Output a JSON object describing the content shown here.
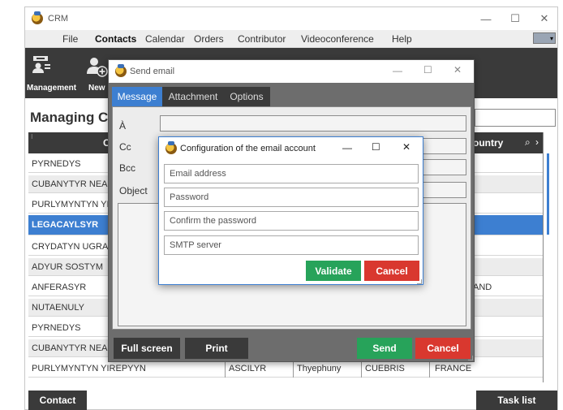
{
  "app": {
    "title": "CRM"
  },
  "menu": [
    "File",
    "Contacts",
    "Calendar",
    "Orders",
    "Contributor",
    "Videoconference",
    "Help"
  ],
  "menu_active": "Contacts",
  "ribbon": {
    "management": "Management",
    "new": "New"
  },
  "page_title": "Managing C",
  "grid": {
    "col2_header": "C",
    "country_header": "ountry",
    "rows": [
      {
        "name": "PYRNEDYS",
        "c2": "",
        "c3": "",
        "c4": "",
        "country": ""
      },
      {
        "name": "CUBANYTYR NEASY",
        "c2": "",
        "c3": "",
        "c4": "",
        "country": ""
      },
      {
        "name": "PURLYMYNTYN YIR",
        "c2": "",
        "c3": "",
        "c4": "",
        "country": ""
      },
      {
        "name": "LEGACAYLSYR",
        "c2": "",
        "c3": "",
        "c4": "",
        "country": ""
      },
      {
        "name": "CRYDATYN UGRACE",
        "c2": "",
        "c3": "",
        "c4": "",
        "country": ""
      },
      {
        "name": "ADYUR SOSTYM",
        "c2": "",
        "c3": "",
        "c4": "",
        "country": ""
      },
      {
        "name": "ANFERASYR",
        "c2": "",
        "c3": "",
        "c4": "",
        "country": "AND"
      },
      {
        "name": "NUTAENULY",
        "c2": "",
        "c3": "",
        "c4": "",
        "country": ""
      },
      {
        "name": "PYRNEDYS",
        "c2": "",
        "c3": "",
        "c4": "",
        "country": ""
      },
      {
        "name": "CUBANYTYR NEASY",
        "c2": "",
        "c3": "",
        "c4": "",
        "country": ""
      },
      {
        "name": "PURLYMYNTYN YIREPYYN",
        "c2": "ASCILYR",
        "c3": "Thyephuny",
        "c4": "CUEBRIS",
        "country": "FRANCE"
      }
    ]
  },
  "bottom": {
    "contact": "Contact",
    "task_list": "Task list"
  },
  "send_email": {
    "title": "Send email",
    "tabs": [
      "Message",
      "Attachment",
      "Options"
    ],
    "labels": {
      "to": "À",
      "cc": "Cc",
      "bcc": "Bcc",
      "object": "Object"
    },
    "buttons": {
      "full_screen": "Full screen",
      "print": "Print",
      "send": "Send",
      "cancel": "Cancel"
    }
  },
  "config": {
    "title": "Configuration of the email account",
    "placeholders": {
      "email": "Email address",
      "password": "Password",
      "confirm": "Confirm the password",
      "smtp": "SMTP server"
    },
    "buttons": {
      "validate": "Validate",
      "cancel": "Cancel"
    }
  },
  "colors": {
    "dark": "#3a3a3a",
    "selected": "#3d7fd1",
    "green": "#27a35a",
    "red": "#d9382f",
    "tab_active": "#3d7fd1"
  }
}
